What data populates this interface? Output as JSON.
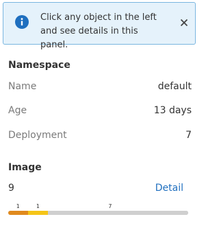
{
  "banner": {
    "text": "Click any object in the left and see details in this panel.",
    "info_icon": "info-icon",
    "close_icon": "close-icon",
    "background": "#e5f2fb",
    "border": "#7ab6e0",
    "icon_color": "#1f6fbf"
  },
  "namespace": {
    "title": "Namespace",
    "rows": [
      {
        "label": "Name",
        "value": "default"
      },
      {
        "label": "Age",
        "value": "13 days"
      },
      {
        "label": "Deployment",
        "value": "7"
      }
    ]
  },
  "image": {
    "title": "Image",
    "count": "9",
    "detail_link": "Detail",
    "link_color": "#1f6fbf",
    "segments": [
      {
        "label": "1",
        "value": 1,
        "color": "#e08a1e"
      },
      {
        "label": "1",
        "value": 1,
        "color": "#f5c518"
      },
      {
        "label": "7",
        "value": 7,
        "color": "#cfcfcf"
      }
    ]
  }
}
